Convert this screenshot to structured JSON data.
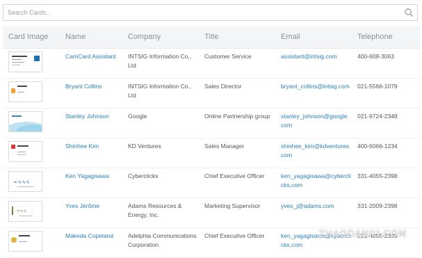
{
  "search": {
    "placeholder": "Search Cards..."
  },
  "table": {
    "headers": [
      "Card Image",
      "Name",
      "Company",
      "Title",
      "Email",
      "Telephone"
    ],
    "rows": [
      {
        "name": "CamCard Assistant",
        "company": "INTSIG Information Co., Ltd",
        "title": "Customer Service",
        "email": "assistant@intsig.com",
        "telephone": "400-608-3063",
        "thumb": "camcard"
      },
      {
        "name": "Bryant Collins",
        "company": "INTSIG Information Co., Ltd",
        "title": "Sales Director",
        "email": "bryant_collins@intsig.com",
        "telephone": "021-5566-1079",
        "thumb": "orange"
      },
      {
        "name": "Stanley Johnson",
        "company": "Google",
        "title": "Online Partnership group",
        "email": "stanley_johnson@google.com",
        "telephone": "021-9724-2348",
        "thumb": "wave"
      },
      {
        "name": "Shinhee Kim",
        "company": "KD Ventures",
        "title": "Sales Manager",
        "email": "shinhee_kim@kdventures.com",
        "telephone": "400-6066-1234",
        "thumb": "red"
      },
      {
        "name": "Ken Yagagisawa",
        "company": "Cyberclicks",
        "title": "Chief Executive Officer",
        "email": "ken_yagagisawa@cyberclicks,com",
        "telephone": "331-4055-2398",
        "thumb": "script"
      },
      {
        "name": "Yves Jérôme",
        "company": "Adams Resources & Energy, Inc.",
        "title": "Marketing Supervisor",
        "email": "yves_j@adams.com",
        "telephone": "331-2009-2398",
        "thumb": "tree"
      },
      {
        "name": "Makeda Copeland",
        "company": "Adelphia Communications Corporation",
        "title": "Chief Executive Officer",
        "email": "ken_yagagisawa@cyberclicks,com",
        "telephone": "331-4055-2398",
        "thumb": "gold"
      }
    ]
  },
  "watermark": "ZHAODANIU.COM",
  "icons": {
    "search": "search-icon"
  },
  "colors": {
    "link": "#2a7fb4",
    "header_bg": "#f4f5f6"
  }
}
